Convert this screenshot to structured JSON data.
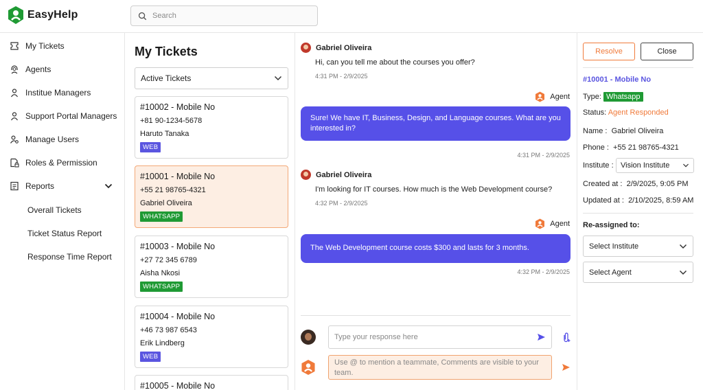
{
  "app": {
    "name": "EasyHelp"
  },
  "search": {
    "placeholder": "Search"
  },
  "sidebar": {
    "items": [
      {
        "label": "My Tickets"
      },
      {
        "label": "Agents"
      },
      {
        "label": "Institue Managers"
      },
      {
        "label": "Support Portal Managers"
      },
      {
        "label": "Manage Users"
      },
      {
        "label": "Roles & Permission"
      },
      {
        "label": "Reports"
      }
    ],
    "reports_sub": [
      {
        "label": "Overall Tickets"
      },
      {
        "label": "Ticket Status Report"
      },
      {
        "label": "Response Time Report"
      }
    ]
  },
  "tickets": {
    "title": "My Tickets",
    "filter": "Active Tickets",
    "items": [
      {
        "id": "#10002 - Mobile No",
        "phone": "+81 90-1234-5678",
        "name": "Haruto Tanaka",
        "channel": "WEB"
      },
      {
        "id": "#10001 - Mobile No",
        "phone": "+55 21 98765-4321",
        "name": "Gabriel Oliveira",
        "channel": "WHATSAPP"
      },
      {
        "id": "#10003 - Mobile No",
        "phone": "+27 72 345 6789",
        "name": "Aisha Nkosi",
        "channel": "WHATSAPP"
      },
      {
        "id": "#10004 - Mobile No",
        "phone": "+46 73 987 6543",
        "name": "Erik Lindberg",
        "channel": "WEB"
      },
      {
        "id": "#10005 - Mobile No"
      }
    ]
  },
  "chat": {
    "messages": [
      {
        "sender": "Gabriel Oliveira",
        "text": "Hi, can you tell me about the courses you offer?",
        "time": "4:31 PM - 2/9/2025"
      },
      {
        "sender": "Agent",
        "text": "Sure! We have IT, Business, Design, and Language courses. What are you interested in?",
        "time": "4:31 PM - 2/9/2025"
      },
      {
        "sender": "Gabriel Oliveira",
        "text": "I'm looking for IT courses. How much is the Web Development course?",
        "time": "4:32 PM - 2/9/2025"
      },
      {
        "sender": "Agent",
        "text": "The Web Development course costs $300 and lasts for 3 months.",
        "time": "4:32 PM - 2/9/2025"
      }
    ],
    "reply_placeholder": "Type your response here",
    "note_placeholder": "Use @ to mention a teammate, Comments are visible to your team."
  },
  "details": {
    "resolve_label": "Resolve",
    "close_label": "Close",
    "ticket_id": "#10001  -  Mobile No",
    "type_label": "Type:",
    "type_value": "Whatsapp",
    "status_label": "Status:",
    "status_value": "Agent Responded",
    "name_label": "Name :",
    "name_value": "Gabriel Oliveira",
    "phone_label": "Phone :",
    "phone_value": "+55 21 98765-4321",
    "institute_label": "Institute :",
    "institute_value": "Vision  Institute",
    "created_label": "Created at :",
    "created_value": "2/9/2025, 9:05 PM",
    "updated_label": "Updated at :",
    "updated_value": "2/10/2025, 8:59 AM",
    "reassigned_label": "Re-assigned to:",
    "select_institute": "Select Institute",
    "select_agent": "Select Agent"
  },
  "colors": {
    "brand_green": "#1f9a34",
    "accent_purple": "#5650e8",
    "accent_orange": "#f07a3a"
  }
}
